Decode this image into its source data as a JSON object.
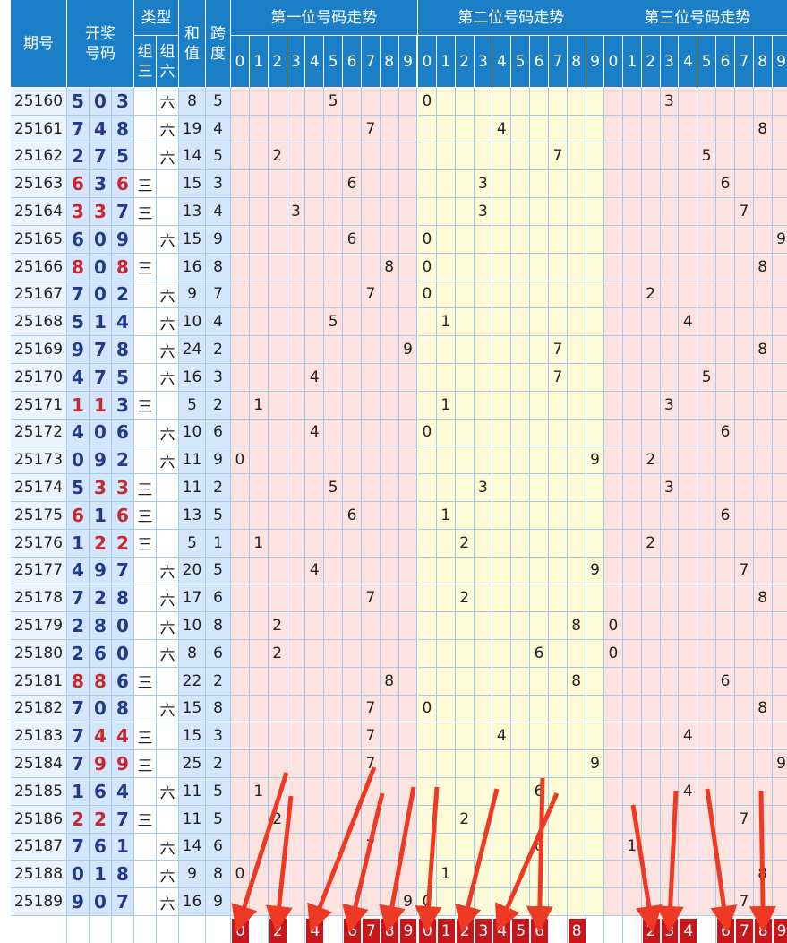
{
  "headers": {
    "period": "期号",
    "open": "开奖号码",
    "type": "类型",
    "zu3": "组三",
    "zu6": "组六",
    "sum": "和值",
    "span": "跨度",
    "pos1": "第一位号码走势",
    "pos2": "第二位号码走势",
    "pos3": "第三位号码走势"
  },
  "digit_headers": [
    "0",
    "1",
    "2",
    "3",
    "4",
    "5",
    "6",
    "7",
    "8",
    "9"
  ],
  "rows": [
    {
      "period": "25160",
      "n": [
        5,
        0,
        3
      ],
      "t": "六",
      "sum": "8",
      "span": "5"
    },
    {
      "period": "25161",
      "n": [
        7,
        4,
        8
      ],
      "t": "六",
      "sum": "19",
      "span": "4"
    },
    {
      "period": "25162",
      "n": [
        2,
        7,
        5
      ],
      "t": "六",
      "sum": "14",
      "span": "5"
    },
    {
      "period": "25163",
      "n": [
        6,
        3,
        6
      ],
      "t": "三",
      "sum": "15",
      "span": "3"
    },
    {
      "period": "25164",
      "n": [
        3,
        3,
        7
      ],
      "t": "三",
      "sum": "13",
      "span": "4"
    },
    {
      "period": "25165",
      "n": [
        6,
        0,
        9
      ],
      "t": "六",
      "sum": "15",
      "span": "9"
    },
    {
      "period": "25166",
      "n": [
        8,
        0,
        8
      ],
      "t": "三",
      "sum": "16",
      "span": "8"
    },
    {
      "period": "25167",
      "n": [
        7,
        0,
        2
      ],
      "t": "六",
      "sum": "9",
      "span": "7"
    },
    {
      "period": "25168",
      "n": [
        5,
        1,
        4
      ],
      "t": "六",
      "sum": "10",
      "span": "4"
    },
    {
      "period": "25169",
      "n": [
        9,
        7,
        8
      ],
      "t": "六",
      "sum": "24",
      "span": "2"
    },
    {
      "period": "25170",
      "n": [
        4,
        7,
        5
      ],
      "t": "六",
      "sum": "16",
      "span": "3"
    },
    {
      "period": "25171",
      "n": [
        1,
        1,
        3
      ],
      "t": "三",
      "sum": "5",
      "span": "2"
    },
    {
      "period": "25172",
      "n": [
        4,
        0,
        6
      ],
      "t": "六",
      "sum": "10",
      "span": "6"
    },
    {
      "period": "25173",
      "n": [
        0,
        9,
        2
      ],
      "t": "六",
      "sum": "11",
      "span": "9"
    },
    {
      "period": "25174",
      "n": [
        5,
        3,
        3
      ],
      "t": "三",
      "sum": "11",
      "span": "2"
    },
    {
      "period": "25175",
      "n": [
        6,
        1,
        6
      ],
      "t": "三",
      "sum": "13",
      "span": "5"
    },
    {
      "period": "25176",
      "n": [
        1,
        2,
        2
      ],
      "t": "三",
      "sum": "5",
      "span": "1"
    },
    {
      "period": "25177",
      "n": [
        4,
        9,
        7
      ],
      "t": "六",
      "sum": "20",
      "span": "5"
    },
    {
      "period": "25178",
      "n": [
        7,
        2,
        8
      ],
      "t": "六",
      "sum": "17",
      "span": "6"
    },
    {
      "period": "25179",
      "n": [
        2,
        8,
        0
      ],
      "t": "六",
      "sum": "10",
      "span": "8"
    },
    {
      "period": "25180",
      "n": [
        2,
        6,
        0
      ],
      "t": "六",
      "sum": "8",
      "span": "6"
    },
    {
      "period": "25181",
      "n": [
        8,
        8,
        6
      ],
      "t": "三",
      "sum": "22",
      "span": "2"
    },
    {
      "period": "25182",
      "n": [
        7,
        0,
        8
      ],
      "t": "六",
      "sum": "15",
      "span": "8"
    },
    {
      "period": "25183",
      "n": [
        7,
        4,
        4
      ],
      "t": "三",
      "sum": "15",
      "span": "3"
    },
    {
      "period": "25184",
      "n": [
        7,
        9,
        9
      ],
      "t": "三",
      "sum": "25",
      "span": "2"
    },
    {
      "period": "25185",
      "n": [
        1,
        6,
        4
      ],
      "t": "六",
      "sum": "11",
      "span": "5"
    },
    {
      "period": "25186",
      "n": [
        2,
        2,
        7
      ],
      "t": "三",
      "sum": "11",
      "span": "5"
    },
    {
      "period": "25187",
      "n": [
        7,
        6,
        1
      ],
      "t": "六",
      "sum": "14",
      "span": "6"
    },
    {
      "period": "25188",
      "n": [
        0,
        1,
        8
      ],
      "t": "六",
      "sum": "9",
      "span": "8"
    },
    {
      "period": "25189",
      "n": [
        9,
        0,
        7
      ],
      "t": "六",
      "sum": "16",
      "span": "9"
    }
  ],
  "prediction": {
    "pos1": [
      "0",
      "2",
      "4",
      "6",
      "7",
      "8",
      "9"
    ],
    "pos2": [
      "0",
      "1",
      "2",
      "3",
      "4",
      "5",
      "6",
      "8"
    ],
    "pos3": [
      "2",
      "3",
      "4",
      "6",
      "7",
      "8",
      "9"
    ]
  },
  "colors": {
    "header": "#1a7fc6",
    "number": "#223a8a",
    "repeat_number": "#c6282c",
    "pick_box": "#c8161d",
    "arrow": "#ee3a24"
  }
}
